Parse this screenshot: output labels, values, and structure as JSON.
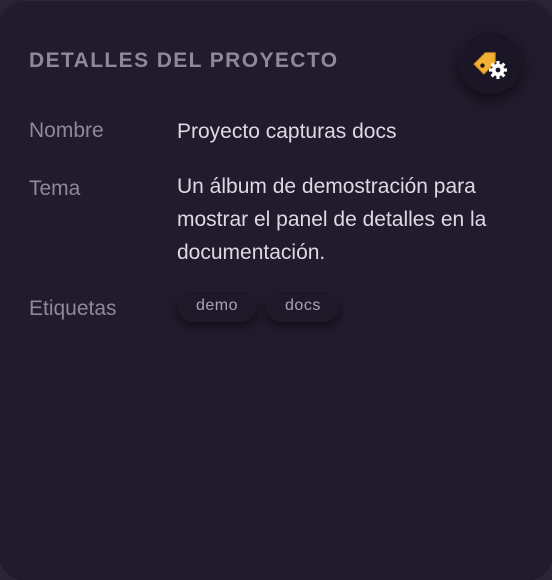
{
  "panel": {
    "title": "DETALLES DEL PROYECTO",
    "action_icon": "tag-settings-icon",
    "accent_color": "#f2b134"
  },
  "fields": {
    "name": {
      "label": "Nombre",
      "value": "Proyecto capturas docs"
    },
    "theme": {
      "label": "Tema",
      "value": "Un álbum de demostración para mostrar el panel de detalles en la documentación."
    },
    "tags": {
      "label": "Etiquetas",
      "items": [
        "demo",
        "docs"
      ]
    }
  }
}
